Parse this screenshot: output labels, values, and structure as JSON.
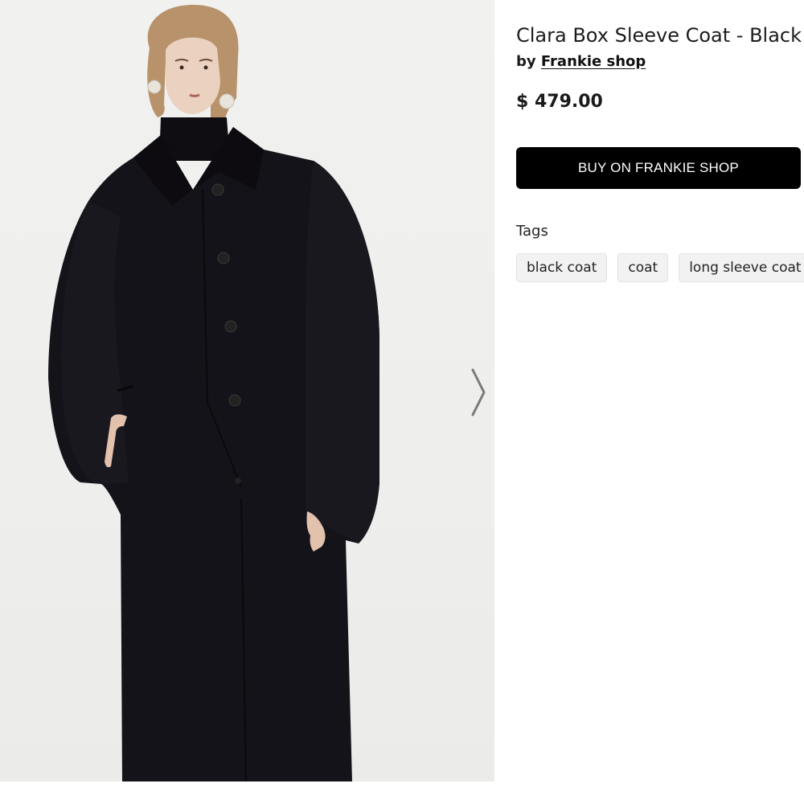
{
  "product": {
    "title": "Clara Box Sleeve Coat - Black",
    "brand_prefix": "by",
    "brand": "Frankie shop",
    "price": "$ 479.00",
    "buy_label": "BUY ON FRANKIE SHOP"
  },
  "tags": {
    "label": "Tags",
    "items": [
      "black coat",
      "coat",
      "long sleeve coat"
    ]
  },
  "gallery": {
    "image_alt": "Model wearing a long black oversized wool coat over a black turtleneck",
    "next_icon": "chevron-right-icon"
  },
  "colors": {
    "button_bg": "#000000",
    "button_text": "#ffffff",
    "tag_bg": "#f2f2f2",
    "coat": "#15131a"
  }
}
